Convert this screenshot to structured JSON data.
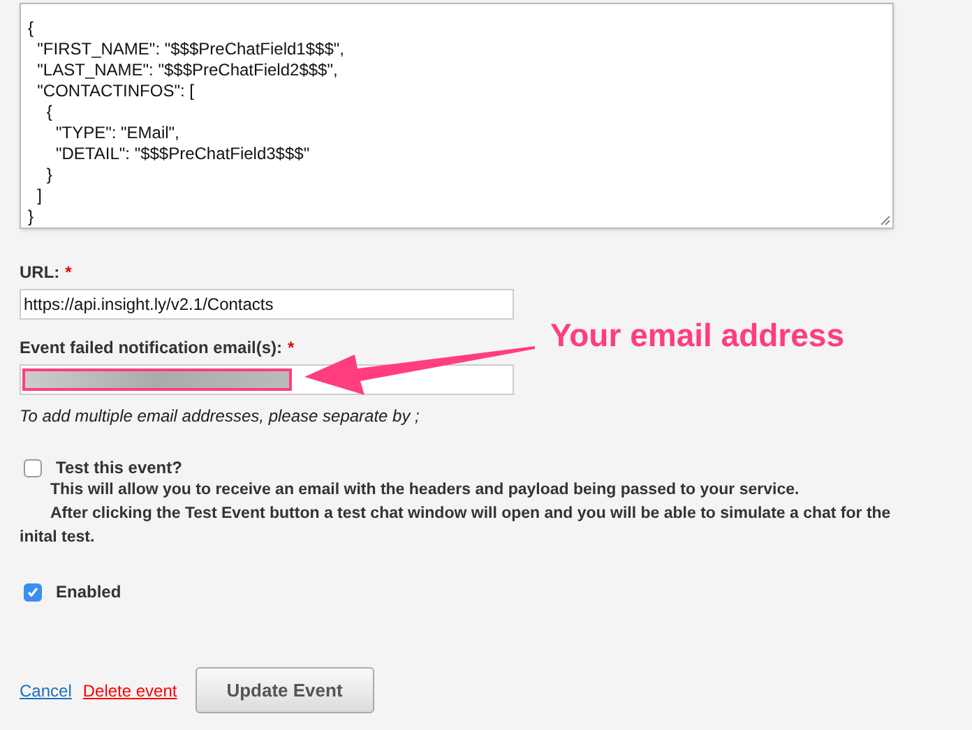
{
  "payload_editor": {
    "lines": [
      "{",
      "  \"FIRST_NAME\": \"$$$PreChatField1$$$\",",
      "  \"LAST_NAME\": \"$$$PreChatField2$$$\",",
      "  \"CONTACTINFOS\": [",
      "    {",
      "      \"TYPE\": \"EMail\",",
      "      \"DETAIL\": \"$$$PreChatField3$$$\"",
      "    }",
      "  ]",
      "}"
    ]
  },
  "url": {
    "label": "URL:",
    "required": true,
    "required_mark": "*",
    "value": "https://api.insight.ly/v2.1/Contacts"
  },
  "notification_email": {
    "label": "Event failed notification email(s):",
    "required": true,
    "required_mark": "*",
    "hint": "To add multiple email addresses, please separate by ;"
  },
  "annotation": {
    "text": "Your email address"
  },
  "test_event": {
    "label": "Test this event?",
    "checked": false,
    "description": [
      "This will allow you to receive an email with the headers and payload being passed to your service.",
      "After clicking the Test Event button a test chat window will open and you will be able to simulate a chat for the inital test."
    ]
  },
  "enabled": {
    "label": "Enabled",
    "checked": true
  },
  "actions": {
    "cancel": "Cancel",
    "delete": "Delete event",
    "submit": "Update Event"
  }
}
